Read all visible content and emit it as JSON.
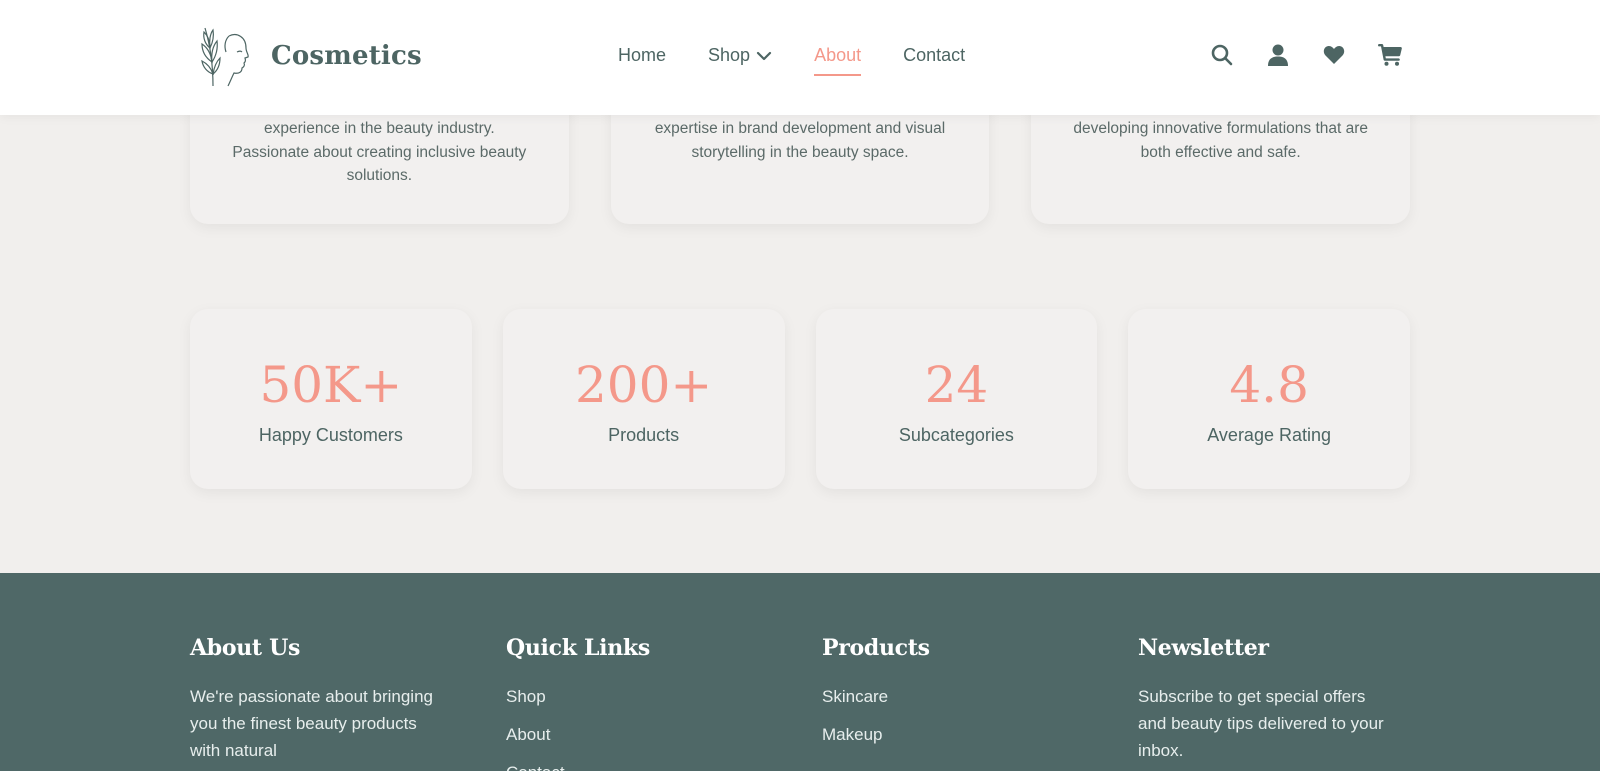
{
  "header": {
    "brand": "Cosmetics",
    "nav": [
      {
        "label": "Home"
      },
      {
        "label": "Shop"
      },
      {
        "label": "About"
      },
      {
        "label": "Contact"
      }
    ],
    "active": "About",
    "icons": [
      "search-icon",
      "user-icon",
      "heart-icon",
      "cart-icon"
    ],
    "colors": {
      "accent": "#f4988a",
      "primary": "#4d6563"
    }
  },
  "team": [
    {
      "bio_lines": [
        "experience in the beauty industry.",
        "Passionate about creating inclusive beauty",
        "solutions."
      ]
    },
    {
      "bio_lines": [
        "expertise in brand development and visual",
        "storytelling in the beauty space."
      ]
    },
    {
      "bio_lines": [
        "developing innovative formulations that are",
        "both effective and safe."
      ]
    }
  ],
  "stats": [
    {
      "value": "50K+",
      "label": "Happy Customers"
    },
    {
      "value": "200+",
      "label": "Products"
    },
    {
      "value": "24",
      "label": "Subcategories"
    },
    {
      "value": "4.8",
      "label": "Average Rating"
    }
  ],
  "footer": {
    "about": {
      "title": "About Us",
      "text": "We're passionate about bringing you the finest beauty products with natural"
    },
    "quick_links": {
      "title": "Quick Links",
      "items": [
        "Shop",
        "About",
        "Contact"
      ]
    },
    "products": {
      "title": "Products",
      "items": [
        "Skincare",
        "Makeup"
      ]
    },
    "newsletter": {
      "title": "Newsletter",
      "text": "Subscribe to get special offers and beauty tips delivered to your inbox."
    },
    "colors": {
      "background": "#4f6867"
    }
  }
}
